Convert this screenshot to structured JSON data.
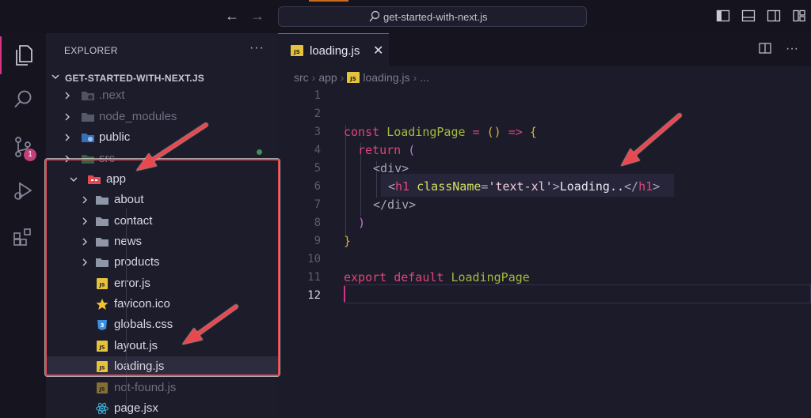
{
  "titlebar": {
    "search_text": "get-started-with-next.js",
    "back_icon": "arrow-left-icon",
    "forward_icon": "arrow-right-icon"
  },
  "activitybar": {
    "scm_badge": "1"
  },
  "sidebar": {
    "header": "EXPLORER",
    "more": "···",
    "project": "GET-STARTED-WITH-NEXT.JS",
    "items": [
      {
        "label": ".next",
        "kind": "folder",
        "level": 1,
        "dim": true
      },
      {
        "label": "node_modules",
        "kind": "folder",
        "level": 1,
        "dim": true
      },
      {
        "label": "public",
        "kind": "folder",
        "level": 1,
        "dim": false
      },
      {
        "label": "src",
        "kind": "folder",
        "level": 1,
        "dim": true
      },
      {
        "label": "app",
        "kind": "folder-open",
        "level": 2,
        "dim": false
      },
      {
        "label": "about",
        "kind": "folder",
        "level": 3,
        "dim": false
      },
      {
        "label": "contact",
        "kind": "folder",
        "level": 3,
        "dim": false
      },
      {
        "label": "news",
        "kind": "folder",
        "level": 3,
        "dim": false
      },
      {
        "label": "products",
        "kind": "folder",
        "level": 3,
        "dim": false
      },
      {
        "label": "error.js",
        "kind": "js",
        "level": 3,
        "dim": false
      },
      {
        "label": "favicon.ico",
        "kind": "star",
        "level": 3,
        "dim": false
      },
      {
        "label": "globals.css",
        "kind": "css",
        "level": 3,
        "dim": false
      },
      {
        "label": "layout.js",
        "kind": "js",
        "level": 3,
        "dim": false
      },
      {
        "label": "loading.js",
        "kind": "js",
        "level": 3,
        "dim": false,
        "selected": true
      },
      {
        "label": "not-found.js",
        "kind": "js",
        "level": 3,
        "dim": true
      },
      {
        "label": "page.jsx",
        "kind": "react",
        "level": 3,
        "dim": false
      }
    ]
  },
  "editor": {
    "tab_label": "loading.js",
    "tab_close": "✕",
    "breadcrumb": [
      "src",
      "app",
      "loading.js",
      "..."
    ],
    "line_numbers": [
      "1",
      "2",
      "3",
      "4",
      "5",
      "6",
      "7",
      "8",
      "9",
      "10",
      "11",
      "12"
    ],
    "code": {
      "l3_kw": "const",
      "l3_fn": "LoadingPage",
      "l3_eq": "=",
      "l3_paren": "()",
      "l3_arrow": "=>",
      "l3_brace": "{",
      "l4_kw": "return",
      "l4_paren": "(",
      "l5": "<div>",
      "l6_open": "<",
      "l6_tag": "h1",
      "l6_attr": "className",
      "l6_eq": "=",
      "l6_str": "'text-xl'",
      "l6_gt": ">",
      "l6_text": "Loading..",
      "l6_close_open": "</",
      "l6_close_tag": "h1",
      "l6_close_gt": ">",
      "l7": "</div>",
      "l8": ")",
      "l9": "}",
      "l11_kw1": "export",
      "l11_kw2": "default",
      "l11_fn": "LoadingPage"
    }
  },
  "colors": {
    "accent": "#d63384",
    "highlight_box": "#e8494f"
  }
}
